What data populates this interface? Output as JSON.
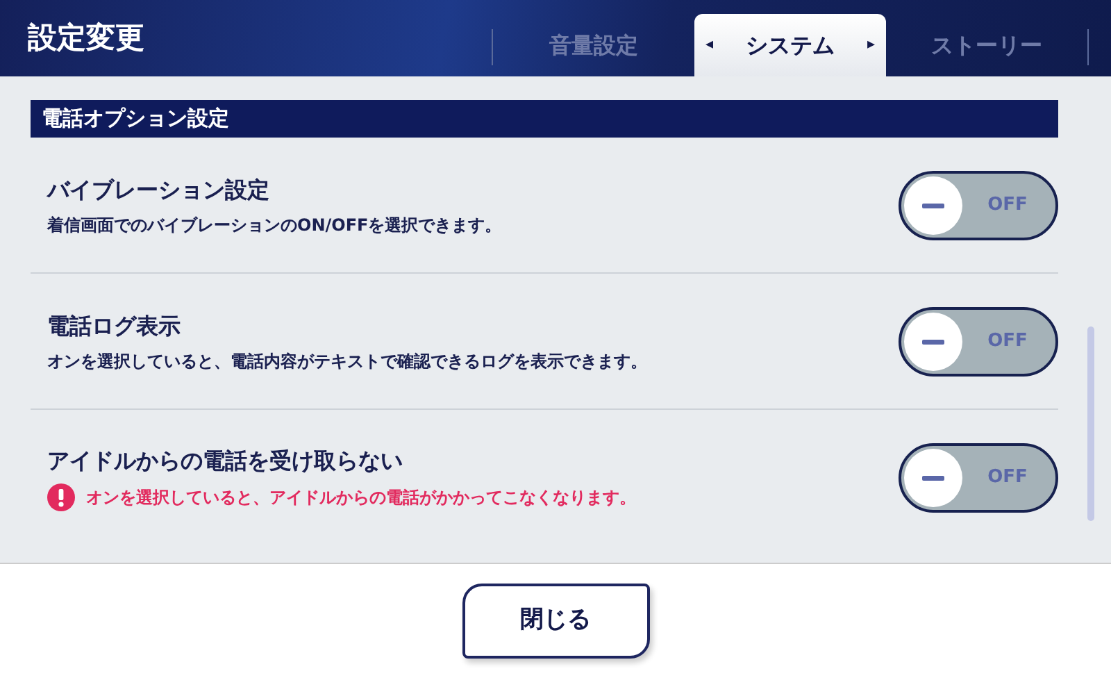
{
  "header": {
    "title": "設定変更"
  },
  "tabs": [
    {
      "label": "音量設定",
      "selected": false
    },
    {
      "label": "システム",
      "selected": true,
      "prev_arrow": "◂",
      "next_arrow": "▸"
    },
    {
      "label": "ストーリー",
      "selected": false
    }
  ],
  "section": {
    "title": "電話オプション設定"
  },
  "settings": [
    {
      "title": "バイブレーション設定",
      "note": {
        "kind": "plain",
        "text": "着信画面でのバイブレーションのON/OFFを選択できます。"
      },
      "toggle": {
        "on": false,
        "label": "OFF"
      }
    },
    {
      "title": "電話ログ表示",
      "note": {
        "kind": "plain",
        "text": "オンを選択していると、電話内容がテキストで確認できるログを表示できます。"
      },
      "toggle": {
        "on": false,
        "label": "OFF"
      }
    },
    {
      "title": "アイドルからの電話を受け取らない",
      "note": {
        "kind": "warning",
        "text": "オンを選択していると、アイドルからの電話がかかってこなくなります。"
      },
      "toggle": {
        "on": false,
        "label": "OFF"
      }
    }
  ],
  "footer": {
    "close_button": "閉じる"
  }
}
